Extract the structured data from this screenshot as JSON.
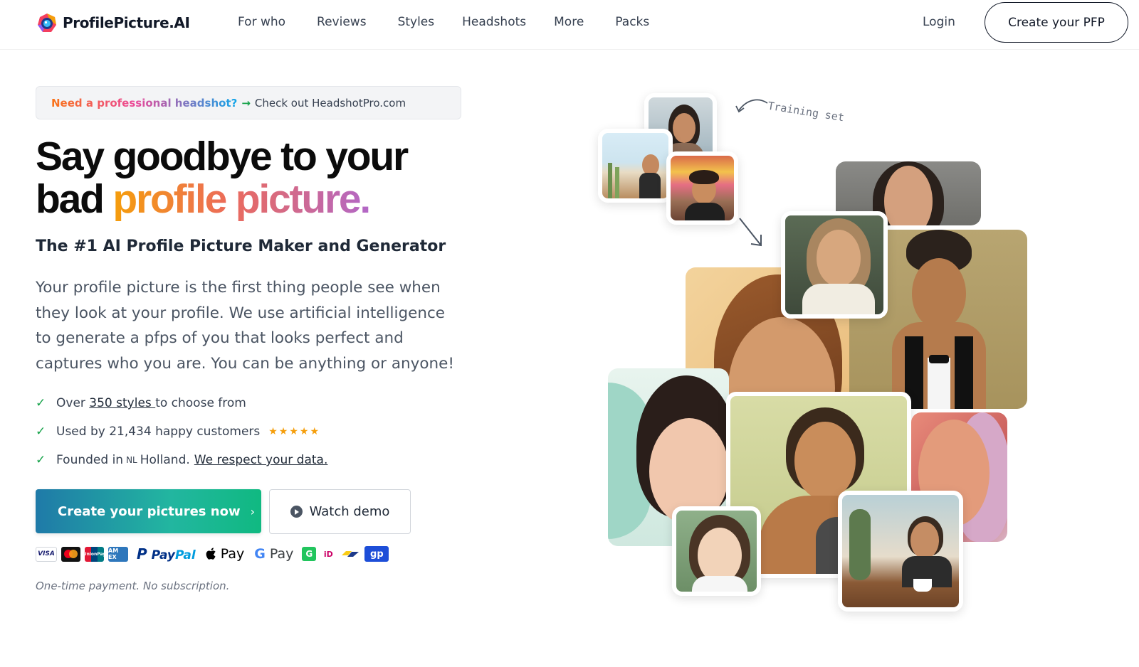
{
  "header": {
    "brand": "ProfilePicture.AI",
    "nav": [
      "For who",
      "Reviews",
      "Styles",
      "Headshots",
      "More",
      "Packs"
    ],
    "login": "Login",
    "cta": "Create your PFP"
  },
  "banner": {
    "strong": "Need a professional headshot?",
    "arrow": "→",
    "link": "Check out HeadshotPro.com"
  },
  "hero": {
    "headline_line1": "Say goodbye to your",
    "headline_line2_plain": "bad ",
    "headline_line2_grad": "profile picture.",
    "subhead": "The #1 AI Profile Picture Maker and Generator",
    "paragraph": "Your profile picture is the first thing people see when they look at your profile. We use artificial intelligence to generate a pfps of you that looks perfect and captures who you are. You can be anything or anyone!"
  },
  "checks": {
    "item1_pre": "Over ",
    "item1_link": "350 styles ",
    "item1_post": "to choose from",
    "item2": "Used by 21,434 happy customers",
    "rating_stars": 5,
    "stars_glyph": "★★★★★",
    "item3_pre": "Founded in",
    "item3_flag": "NL",
    "item3_mid": "Holland.",
    "item3_link": "We respect your data.",
    "check_glyph": "✓"
  },
  "buttons": {
    "primary": "Create your pictures now",
    "primary_chevron": "›",
    "secondary": "Watch demo"
  },
  "payments": {
    "visa": "VISA",
    "unionpay": "UnionPay",
    "amex": "AM EX",
    "paypal_a": "Pay",
    "paypal_b": "Pal",
    "applepay": " Pay",
    "gpay_g": "G",
    "gpay": " Pay",
    "grab": "G",
    "ideal": "iD",
    "gp": "gp"
  },
  "fineprint": "One-time payment. No subscription.",
  "collage": {
    "training_label": "Training set"
  },
  "colors": {
    "cta_gradient_start": "#1f7aa8",
    "cta_gradient_end": "#10b981",
    "headline_gradient": [
      "#f59e0b",
      "#ec6b5a",
      "#b267c7"
    ],
    "star": "#f59e0b",
    "check": "#16a34a"
  },
  "icons": [
    "logo-camera-icon",
    "arrow-right-icon",
    "check-icon",
    "star-icon",
    "chevron-right-icon",
    "play-icon",
    "curved-arrow-icon",
    "down-arrow-icon"
  ]
}
